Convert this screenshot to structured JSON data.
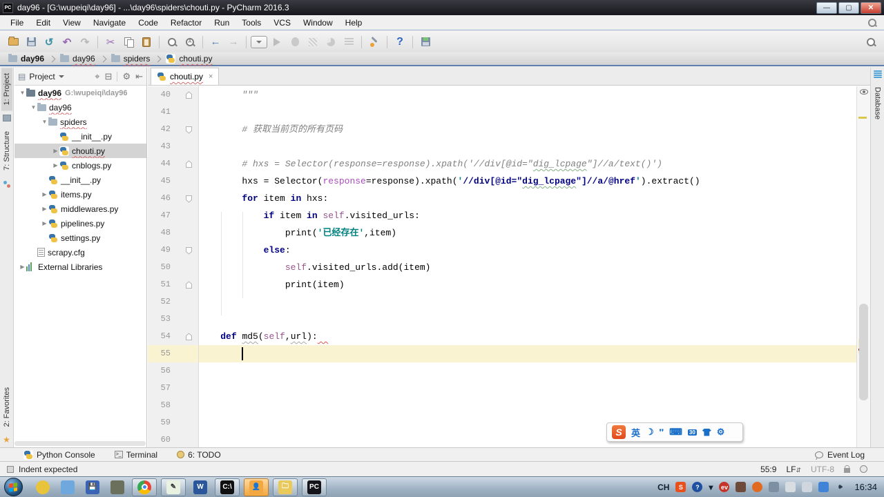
{
  "window": {
    "title": "day96 - [G:\\wupeiqi\\day96] - ...\\day96\\spiders\\chouti.py - PyCharm 2016.3",
    "logo_label": "PC",
    "buttons": {
      "minimize": "—",
      "maximize": "▢",
      "close": "✕"
    }
  },
  "menu": {
    "items": [
      "File",
      "Edit",
      "View",
      "Navigate",
      "Code",
      "Refactor",
      "Run",
      "Tools",
      "VCS",
      "Window",
      "Help"
    ]
  },
  "toolbar": {
    "items": [
      {
        "name": "open-file-icon"
      },
      {
        "name": "save-all-icon"
      },
      {
        "name": "synchronize-icon"
      },
      {
        "name": "undo-icon"
      },
      {
        "name": "redo-icon"
      },
      {
        "sep": true
      },
      {
        "name": "cut-icon"
      },
      {
        "name": "copy-icon"
      },
      {
        "name": "paste-icon"
      },
      {
        "sep": true
      },
      {
        "name": "find-icon"
      },
      {
        "name": "replace-icon"
      },
      {
        "sep": true
      },
      {
        "name": "back-icon"
      },
      {
        "name": "forward-icon"
      },
      {
        "sep": true
      },
      {
        "name": "run-config-dropdown"
      },
      {
        "name": "run-icon"
      },
      {
        "name": "debug-icon"
      },
      {
        "name": "coverage-icon"
      },
      {
        "name": "profile-icon"
      },
      {
        "name": "concurrency-icon"
      },
      {
        "sep": true
      },
      {
        "name": "settings-wrench-icon"
      },
      {
        "sep": true
      },
      {
        "name": "help-icon"
      },
      {
        "sep": true
      },
      {
        "name": "project-structure-icon"
      }
    ],
    "search_icon": "search-everywhere-icon"
  },
  "navbar": {
    "items": [
      {
        "label": "day96",
        "icon": "folder",
        "bold": true,
        "squiggle": false
      },
      {
        "label": "day96",
        "icon": "folder",
        "squiggle": true
      },
      {
        "label": "spiders",
        "icon": "folder",
        "squiggle": true
      },
      {
        "label": "chouti.py",
        "icon": "python",
        "squiggle": true
      }
    ]
  },
  "left_strip": {
    "top": [
      {
        "label": "1: Project",
        "icon": "project-tool-icon",
        "active": true
      },
      {
        "label": "7: Structure",
        "icon": "structure-tool-icon",
        "active": false
      }
    ],
    "bottom": [
      {
        "label": "2: Favorites",
        "icon": "star-icon",
        "active": false
      }
    ]
  },
  "right_strip": {
    "top": [
      {
        "label": "Database",
        "icon": "database-icon",
        "active": false
      }
    ]
  },
  "project_panel": {
    "title": "Project",
    "header_icons": [
      "project-view-icon",
      "dropdown-caret",
      "locate-icon",
      "collapse-all-icon",
      "settings-gear-icon",
      "hide-panel-icon"
    ],
    "tree": [
      {
        "label": "day96",
        "path": "G:\\wupeiqi\\day96",
        "depth": 0,
        "icon": "folder-dark",
        "arrow": "open",
        "bold": true,
        "squiggle": true
      },
      {
        "label": "day96",
        "depth": 1,
        "icon": "folder",
        "arrow": "open",
        "squiggle": true
      },
      {
        "label": "spiders",
        "depth": 2,
        "icon": "folder",
        "arrow": "open",
        "squiggle": true
      },
      {
        "label": "__init__.py",
        "depth": 3,
        "icon": "python",
        "arrow": "none"
      },
      {
        "label": "chouti.py",
        "depth": 3,
        "icon": "python",
        "arrow": "closed",
        "selected": true,
        "squiggle": true
      },
      {
        "label": "cnblogs.py",
        "depth": 3,
        "icon": "python",
        "arrow": "closed"
      },
      {
        "label": "__init__.py",
        "depth": 2,
        "icon": "python",
        "arrow": "none"
      },
      {
        "label": "items.py",
        "depth": 2,
        "icon": "python",
        "arrow": "closed"
      },
      {
        "label": "middlewares.py",
        "depth": 2,
        "icon": "python",
        "arrow": "closed"
      },
      {
        "label": "pipelines.py",
        "depth": 2,
        "icon": "python",
        "arrow": "closed"
      },
      {
        "label": "settings.py",
        "depth": 2,
        "icon": "python",
        "arrow": "none"
      },
      {
        "label": "scrapy.cfg",
        "depth": 1,
        "icon": "config",
        "arrow": "none"
      },
      {
        "label": "External Libraries",
        "depth": 0,
        "icon": "library",
        "arrow": "closed"
      }
    ]
  },
  "editor": {
    "tabs": [
      {
        "label": "chouti.py",
        "icon": "python",
        "close_glyph": "×",
        "active": true,
        "squiggle": true
      }
    ],
    "cursor": {
      "line": 55,
      "col": 9
    },
    "lines": [
      {
        "num": 40,
        "fold": "up",
        "seg": [
          [
            "        \"\"\"",
            "c"
          ]
        ]
      },
      {
        "num": 41,
        "seg": []
      },
      {
        "num": 42,
        "fold": "down",
        "seg": [
          [
            "        ",
            "p"
          ],
          [
            "# 获取当前页的所有页码",
            "c"
          ]
        ]
      },
      {
        "num": 43,
        "seg": []
      },
      {
        "num": 44,
        "fold": "up",
        "seg": [
          [
            "        ",
            "p"
          ],
          [
            "# hxs = Selector(response=response).xpath('//div[@id=\"",
            "c"
          ],
          [
            "dig_lcpage",
            "c",
            "g"
          ],
          [
            "\"]//a/text()')",
            "c"
          ]
        ]
      },
      {
        "num": 45,
        "seg": [
          [
            "        ",
            "p"
          ],
          [
            "hxs = Selector(",
            "p"
          ],
          [
            "response",
            "kw"
          ],
          [
            "=response).xpath(",
            "p"
          ],
          [
            "'",
            "s"
          ],
          [
            "//div[@id=\"",
            "x"
          ],
          [
            "dig_lcpage",
            "x",
            "g"
          ],
          [
            "\"]//a/@href",
            "x"
          ],
          [
            "'",
            "s"
          ],
          [
            ").extract()",
            "p"
          ]
        ]
      },
      {
        "num": 46,
        "fold": "down",
        "seg": [
          [
            "        ",
            "p"
          ],
          [
            "for",
            "k"
          ],
          [
            " item ",
            "p"
          ],
          [
            "in",
            "k"
          ],
          [
            " hxs:",
            "p"
          ]
        ]
      },
      {
        "num": 47,
        "seg": [
          [
            "            ",
            "p"
          ],
          [
            "if",
            "k"
          ],
          [
            " item ",
            "p"
          ],
          [
            "in",
            "k"
          ],
          [
            " ",
            "p"
          ],
          [
            "self",
            "se"
          ],
          [
            ".visited_urls:",
            "p"
          ]
        ]
      },
      {
        "num": 48,
        "seg": [
          [
            "                ",
            "p"
          ],
          [
            "print(",
            "p"
          ],
          [
            "'已经存在'",
            "s"
          ],
          [
            ",item)",
            "p"
          ]
        ]
      },
      {
        "num": 49,
        "fold": "down",
        "seg": [
          [
            "            ",
            "p"
          ],
          [
            "else",
            "k"
          ],
          [
            ":",
            "p"
          ]
        ]
      },
      {
        "num": 50,
        "seg": [
          [
            "                ",
            "p"
          ],
          [
            "self",
            "se"
          ],
          [
            ".visited_urls.add(item)",
            "p"
          ]
        ]
      },
      {
        "num": 51,
        "fold": "up",
        "seg": [
          [
            "                ",
            "p"
          ],
          [
            "print(item)",
            "p"
          ]
        ]
      },
      {
        "num": 52,
        "seg": []
      },
      {
        "num": 53,
        "seg": []
      },
      {
        "num": 54,
        "fold": "up",
        "seg": [
          [
            "    ",
            "p"
          ],
          [
            "def",
            "k"
          ],
          [
            " ",
            "p"
          ],
          [
            "md5",
            "p",
            "y"
          ],
          [
            "(",
            "p"
          ],
          [
            "self",
            "se"
          ],
          [
            ",",
            "p"
          ],
          [
            "url",
            "p",
            "y"
          ],
          [
            "):",
            "p"
          ],
          [
            "  ",
            "p",
            "r"
          ]
        ]
      },
      {
        "num": 55,
        "current": true,
        "seg": []
      },
      {
        "num": 56,
        "seg": []
      },
      {
        "num": 57,
        "seg": []
      },
      {
        "num": 58,
        "seg": []
      },
      {
        "num": 59,
        "seg": []
      },
      {
        "num": 60,
        "seg": []
      }
    ]
  },
  "bottom_bar": {
    "left": [
      {
        "label": "Python Console",
        "icon": "python-icon"
      },
      {
        "label": "Terminal",
        "icon": "terminal-icon"
      },
      {
        "label": "6: TODO",
        "icon": "todo-icon"
      }
    ],
    "right": [
      {
        "label": "Event Log",
        "icon": "event-log-bubble-icon"
      }
    ]
  },
  "statusbar": {
    "message": "Indent expected",
    "position": "55:9",
    "line_ending": "LF",
    "encoding": "UTF-8",
    "icons": [
      "message-square-icon",
      "lock-icon",
      "inspector-icon"
    ]
  },
  "ime_bar": {
    "logo": "S",
    "mode": "英",
    "icons": [
      "moon-icon",
      "punctuation-icon",
      "keyboard-icon",
      "id-photo-icon",
      "skin-shirt-icon",
      "wrench-icon"
    ],
    "glyphs": {
      "moon": "☽",
      "punctuation": "❜❜",
      "keyboard": "⌨",
      "id_photo": "30"
    }
  },
  "taskbar": {
    "apps": [
      {
        "name": "start-button",
        "kind": "orb"
      },
      {
        "name": "paint-app-icon",
        "color": "#e8c33c",
        "round": true
      },
      {
        "name": "screenshot-app-icon",
        "color": "#6fa8dc"
      },
      {
        "name": "backup-app-icon",
        "color": "#3a62b5",
        "label": "💾"
      },
      {
        "name": "pin-tool-icon",
        "color": "#6b705c"
      },
      {
        "name": "chrome-icon",
        "boxed": true,
        "kind": "chrome"
      },
      {
        "name": "notepad-app-icon",
        "boxed": true,
        "color": "#e9f2e0",
        "label": "✎",
        "dark": true
      },
      {
        "name": "word-app-icon",
        "color": "#2b579a",
        "label": "W"
      },
      {
        "name": "cmd-app-icon",
        "boxed": true,
        "color": "#101010",
        "label": "C:\\"
      },
      {
        "name": "image-viewer-icon",
        "boxed": true,
        "active": true,
        "color": "#f2a740",
        "label": "👤"
      },
      {
        "name": "explorer-app-icon",
        "boxed": true,
        "color": "#e8c95a",
        "label": "🗀"
      },
      {
        "name": "pycharm-app-icon",
        "boxed": true,
        "color": "#14141a",
        "label": "PC"
      }
    ],
    "tray": [
      {
        "name": "language-indicator",
        "text": "CH"
      },
      {
        "name": "sogou-tray-icon",
        "label": "S",
        "color": "#e8501e"
      },
      {
        "name": "help-tray-icon",
        "label": "?",
        "color": "#1f4fa0",
        "round": true
      },
      {
        "name": "expand-tray-icon",
        "text": "▾"
      },
      {
        "name": "ev-player-icon",
        "label": "ev",
        "color": "#c4342a",
        "round": true
      },
      {
        "name": "pin-tray-icon",
        "label": "",
        "color": "#6d4a3a"
      },
      {
        "name": "record-tray-icon",
        "label": "",
        "color": "#e06a1f",
        "round": true
      },
      {
        "name": "photo-tray-icon",
        "label": "",
        "color": "#7d8fa3"
      },
      {
        "name": "layers-tray-icon",
        "label": "",
        "color": "#d8dde2",
        "dark": true
      },
      {
        "name": "network-tray-icon",
        "label": "",
        "color": "#cfd6dd",
        "dark": true
      },
      {
        "name": "messenger-tray-icon",
        "label": "",
        "color": "#3f84d6"
      },
      {
        "name": "volume-tray-icon",
        "label": "🕪",
        "color": "transparent",
        "dark": true
      }
    ],
    "clock": "16:34"
  }
}
